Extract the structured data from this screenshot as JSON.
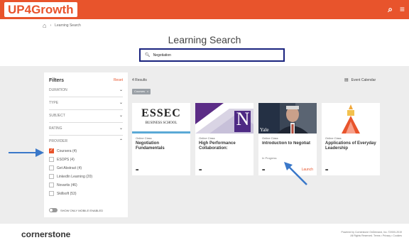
{
  "app": {
    "brand": "UP4Growth"
  },
  "breadcrumb": {
    "current": "Learning Search"
  },
  "page": {
    "title": "Learning Search"
  },
  "search": {
    "value": "Negotiation"
  },
  "filters": {
    "title": "Filters",
    "reset_label": "Reset",
    "facets": [
      "Duration",
      "Type",
      "Subject",
      "Rating",
      "Provider"
    ],
    "provider_options": [
      {
        "label": "Coursera (4)",
        "checked": true
      },
      {
        "label": "ESOPS (4)",
        "checked": false
      },
      {
        "label": "Get Abstract (4)",
        "checked": false
      },
      {
        "label": "LinkedIn Learning (20)",
        "checked": false
      },
      {
        "label": "Novartis (46)",
        "checked": false
      },
      {
        "label": "Skillsoft (53)",
        "checked": false
      }
    ],
    "toggle_label": "Show only mobile enabled"
  },
  "results": {
    "count_label": "4 Results",
    "chip_label": "Courses",
    "chip_close": "×",
    "event_calendar_label": "Event Calendar",
    "cards": [
      {
        "type": "Online Class",
        "title": "Negotiation Fundamentals",
        "status": "",
        "more": "•••",
        "launch": ""
      },
      {
        "type": "Online Class",
        "title": "High Performance Collaboration:",
        "status": "",
        "more": "•••",
        "launch": ""
      },
      {
        "type": "Online Class",
        "title": "Introduction to Negotiation: A Strat",
        "status": "In Progress",
        "more": "•••",
        "launch": "Launch"
      },
      {
        "type": "Online Class",
        "title": "Applications of Everyday Leadership",
        "status": "",
        "more": "•••",
        "launch": ""
      }
    ],
    "thumb_essec": {
      "logo": "ESSEC",
      "sub": "BUSINESS SCHOOL"
    },
    "thumb_nw": {
      "letter": "N"
    },
    "thumb_yale": {
      "text": "Yale"
    }
  },
  "footer": {
    "logo": "cornerstone",
    "line1": "Powered by Cornerstone OnDemand, Inc. ©2000-2019",
    "line2": "All Rights Reserved. Terms • Privacy • Cookies"
  },
  "colors": {
    "accent": "#e8542c",
    "search_border": "#1a237e",
    "arrow": "#3a78c9"
  }
}
